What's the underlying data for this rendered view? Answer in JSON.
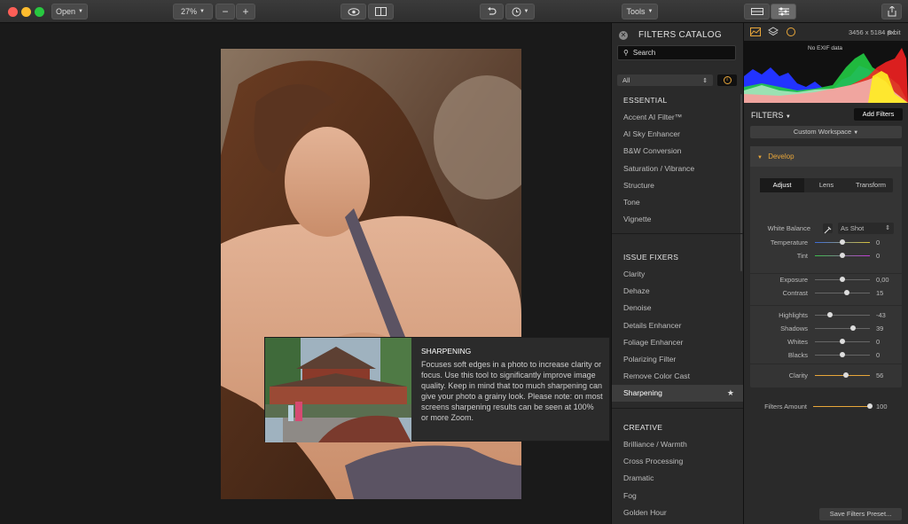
{
  "toolbar": {
    "open_label": "Open",
    "zoom": "27%",
    "zoom_minus": "−",
    "zoom_plus": "+",
    "tools_label": "Tools"
  },
  "tooltip": {
    "title": "SHARPENING",
    "text": "Focuses soft edges in a photo to increase clarity or focus. Use this tool to significantly improve image quality. Keep in mind that too much sharpening can give your photo a grainy look. Please note: on most screens sharpening results can be seen at 100% or more Zoom."
  },
  "catalog": {
    "title": "FILTERS CATALOG",
    "search_placeholder": "Search",
    "filter_select": "All",
    "sections": [
      {
        "name": "ESSENTIAL",
        "items": [
          "Accent AI Filter™",
          "AI Sky Enhancer",
          "B&W Conversion",
          "Saturation / Vibrance",
          "Structure",
          "Tone",
          "Vignette"
        ]
      },
      {
        "name": "ISSUE FIXERS",
        "items": [
          "Clarity",
          "Dehaze",
          "Denoise",
          "Details Enhancer",
          "Foliage Enhancer",
          "Polarizing Filter",
          "Remove Color Cast",
          "Sharpening"
        ]
      },
      {
        "name": "CREATIVE",
        "items": [
          "Brilliance / Warmth",
          "Cross Processing",
          "Dramatic",
          "Fog",
          "Golden Hour"
        ]
      }
    ],
    "selected_item": "Sharpening"
  },
  "right": {
    "dims": "3456 x 5184 px",
    "bitdepth": "8-bit",
    "exif": "No EXIF data",
    "filters_label": "FILTERS",
    "add_filters": "Add Filters",
    "workspace": "Custom Workspace",
    "develop": "Develop",
    "tabs": [
      "Adjust",
      "Lens",
      "Transform"
    ],
    "white_balance_label": "White Balance",
    "white_balance_value": "As Shot",
    "sliders": [
      {
        "label": "Temperature",
        "value": "0",
        "pos": 0.5
      },
      {
        "label": "Tint",
        "value": "0",
        "pos": 0.5
      },
      {
        "label": "Exposure",
        "value": "0,00",
        "pos": 0.5
      },
      {
        "label": "Contrast",
        "value": "15",
        "pos": 0.58
      },
      {
        "label": "Highlights",
        "value": "-43",
        "pos": 0.28
      },
      {
        "label": "Shadows",
        "value": "39",
        "pos": 0.69
      },
      {
        "label": "Whites",
        "value": "0",
        "pos": 0.5
      },
      {
        "label": "Blacks",
        "value": "0",
        "pos": 0.5
      },
      {
        "label": "Clarity",
        "value": "56",
        "pos": 0.56
      }
    ],
    "filters_amount_label": "Filters Amount",
    "filters_amount_value": "100",
    "filters_amount_pos": 1.0,
    "save_preset": "Save Filters Preset..."
  },
  "colors": {
    "accent": "#e8a63a",
    "panel": "#2a2a2a",
    "canvas": "#1a1a1a"
  }
}
